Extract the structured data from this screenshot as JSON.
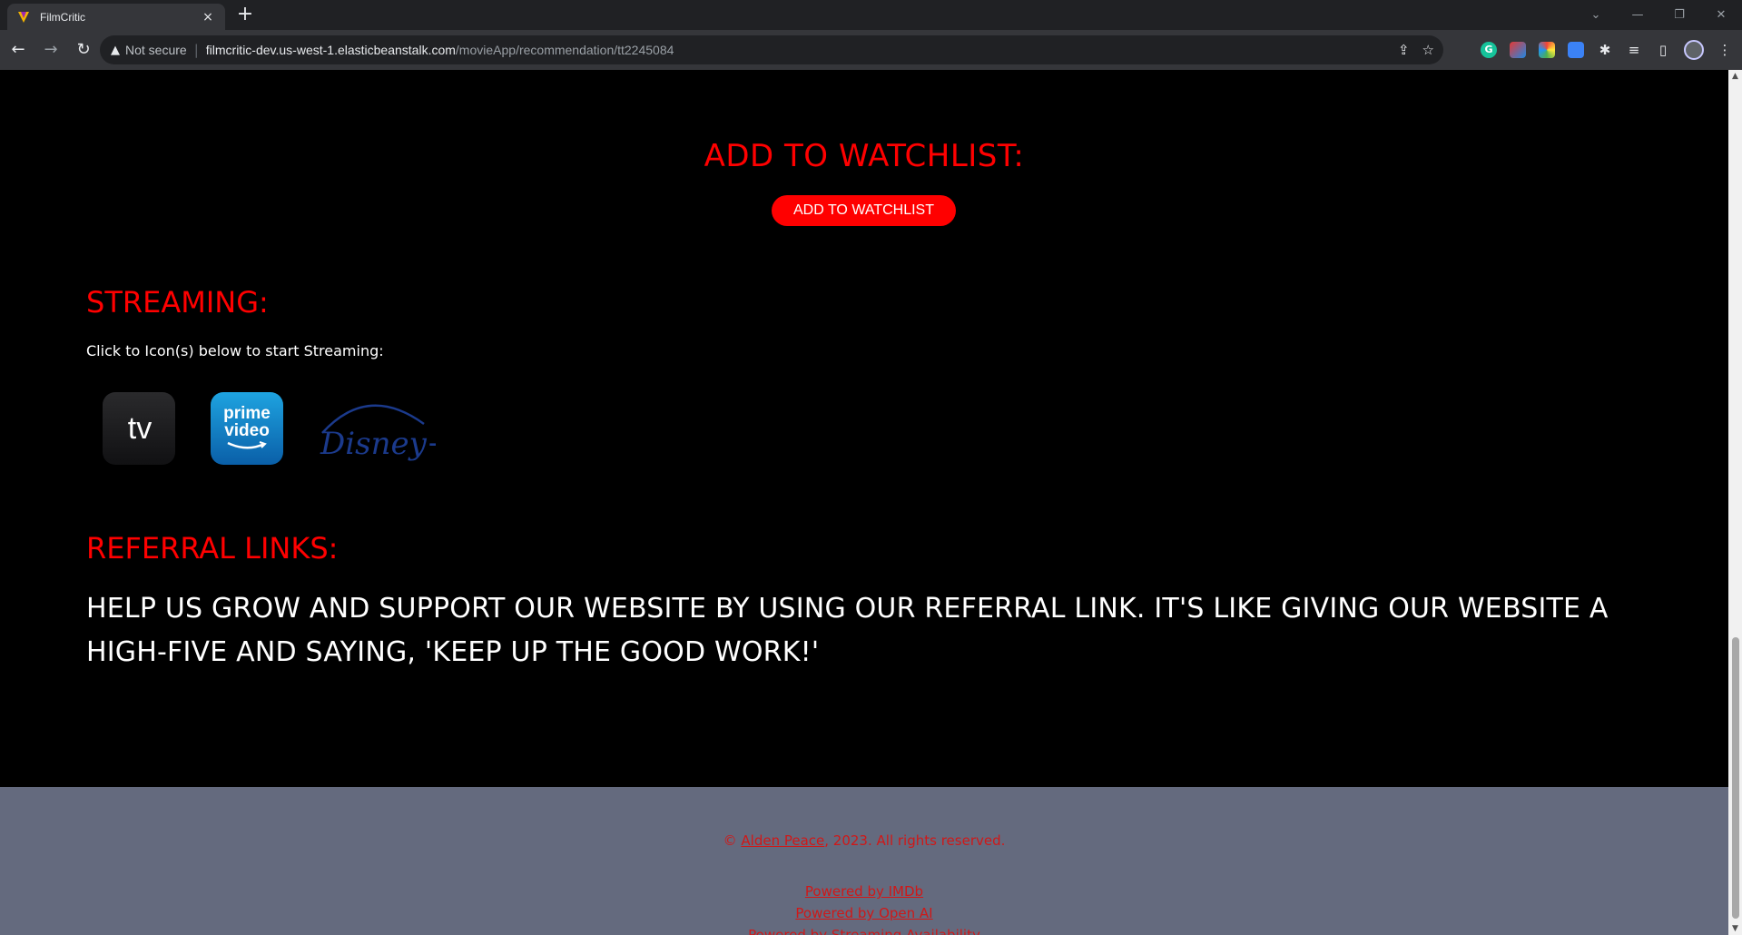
{
  "browser": {
    "tab_title": "FilmCritic",
    "tab_close": "×",
    "new_tab": "+",
    "not_secure": "Not secure",
    "url_host": "filmcritic-dev.us-west-1.elasticbeanstalk.com",
    "url_path": "/movieApp/recommendation/tt2245084",
    "extension_g": "G"
  },
  "watchlist": {
    "heading": "ADD TO WATCHLIST:",
    "button_label": "ADD TO WATCHLIST"
  },
  "streaming": {
    "heading": "STREAMING:",
    "subtitle": "Click to Icon(s) below to start Streaming:",
    "services": [
      {
        "name": "apple-tv",
        "label": "tv"
      },
      {
        "name": "prime-video",
        "label_line1": "prime",
        "label_line2": "video"
      },
      {
        "name": "disney-plus",
        "label": "Disney+"
      }
    ]
  },
  "referral": {
    "heading": "REFERRAL LINKS:",
    "text": "HELP US GROW AND SUPPORT OUR WEBSITE BY USING OUR REFERRAL LINK. IT'S LIKE GIVING OUR WEBSITE A HIGH-FIVE AND SAYING, 'KEEP UP THE GOOD WORK!'"
  },
  "footer": {
    "copyright_prefix": "© ",
    "author": "Alden Peace",
    "copyright_suffix": ", 2023. All rights reserved.",
    "powered_imdb": "Powered by IMDb",
    "powered_openai": "Powered by Open AI",
    "powered_streaming": "Powered by Streaming Availability"
  },
  "colors": {
    "accent_red": "#ff0000",
    "footer_bg": "#646a7e",
    "page_bg": "#000000"
  }
}
